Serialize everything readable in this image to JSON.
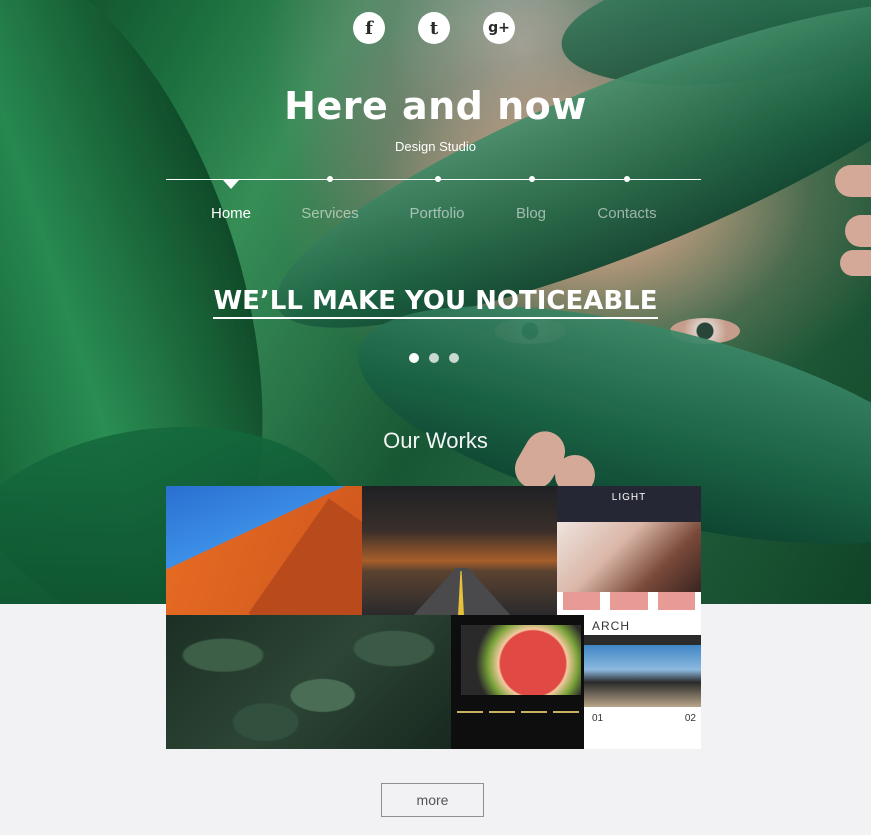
{
  "social": {
    "facebook": "f",
    "twitter": "t",
    "googleplus": "g+"
  },
  "brand": {
    "title": "Here and now",
    "subtitle": "Design Studio"
  },
  "nav": {
    "items": [
      {
        "label": "Home",
        "active": true
      },
      {
        "label": "Services",
        "active": false
      },
      {
        "label": "Portfolio",
        "active": false
      },
      {
        "label": "Blog",
        "active": false
      },
      {
        "label": "Contacts",
        "active": false
      }
    ]
  },
  "hero": {
    "headline": "WE’LL MAKE YOU NOTICEABLE",
    "slides": 3,
    "active_slide": 1
  },
  "works": {
    "title": "Our Works",
    "tiles": [
      {
        "kind": "photo",
        "subject": "orange brick building"
      },
      {
        "kind": "photo",
        "subject": "road at sunset with palm trees"
      },
      {
        "kind": "website",
        "header": "LIGHT"
      },
      {
        "kind": "photo",
        "subject": "dark green leaves"
      },
      {
        "kind": "website",
        "subject": "grapefruit"
      },
      {
        "kind": "website",
        "logo": "ARCH",
        "numbers": [
          "01",
          "02"
        ]
      }
    ]
  },
  "more_button": "more",
  "colors": {
    "page_background": "#f2f2f4",
    "hero_text": "#ffffff",
    "button_border": "#8f8f8f"
  }
}
